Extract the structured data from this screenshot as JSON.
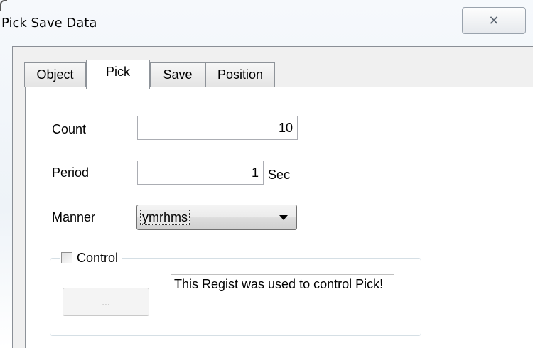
{
  "window": {
    "title": "Pick Save Data",
    "close_glyph": "✕"
  },
  "tabs": [
    {
      "label": "Object",
      "active": false
    },
    {
      "label": "Pick",
      "active": true
    },
    {
      "label": "Save",
      "active": false
    },
    {
      "label": "Position",
      "active": false
    }
  ],
  "pick": {
    "count_label": "Count",
    "count_value": "10",
    "period_label": "Period",
    "period_value": "1",
    "period_unit": "Sec",
    "manner_label": "Manner",
    "manner_value": "ymrhms",
    "control_label": "Control",
    "control_checked": false,
    "browse_label": "...",
    "note_text": "This Regist was used to control Pick!"
  }
}
